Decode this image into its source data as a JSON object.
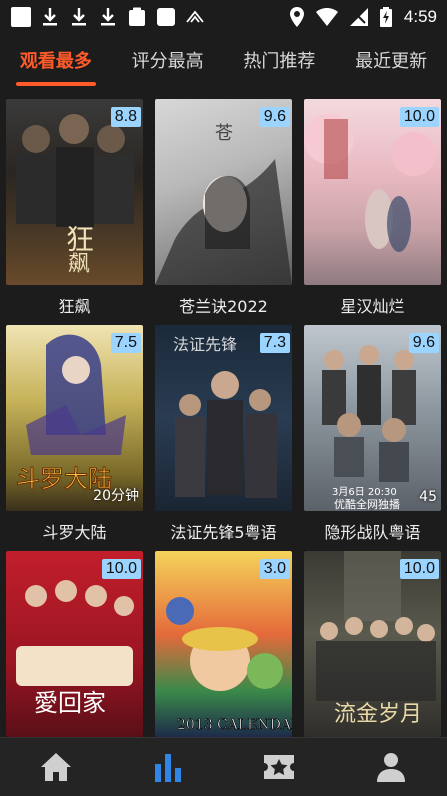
{
  "status_bar": {
    "time": "4:59"
  },
  "tabs": [
    {
      "label": "观看最多",
      "active": true
    },
    {
      "label": "评分最高",
      "active": false
    },
    {
      "label": "热门推荐",
      "active": false
    },
    {
      "label": "最近更新",
      "active": false
    }
  ],
  "items": [
    {
      "title": "狂飙",
      "rating": "8.8",
      "caption": ""
    },
    {
      "title": "苍兰诀2022",
      "rating": "9.6",
      "caption": ""
    },
    {
      "title": "星汉灿烂",
      "rating": "10.0",
      "caption": ""
    },
    {
      "title": "斗罗大陆",
      "rating": "7.5",
      "caption": "20分钟"
    },
    {
      "title": "法证先锋5粤语",
      "rating": "7.3",
      "caption": ""
    },
    {
      "title": "隐形战队粤语",
      "rating": "9.6",
      "caption": "45"
    },
    {
      "title": "",
      "rating": "10.0",
      "caption": ""
    },
    {
      "title": "",
      "rating": "3.0",
      "caption": ""
    },
    {
      "title": "",
      "rating": "10.0",
      "caption": ""
    }
  ],
  "bottom_nav": [
    {
      "icon": "home-icon",
      "active": false
    },
    {
      "icon": "bar-chart-icon",
      "active": true
    },
    {
      "icon": "star-ticket-icon",
      "active": false
    },
    {
      "icon": "person-icon",
      "active": false
    }
  ],
  "colors": {
    "accent": "#ff5a2a",
    "nav_active": "#2f86e6",
    "nav_inactive": "#cfcfcf",
    "rating_bg": "#9ad4ff"
  }
}
